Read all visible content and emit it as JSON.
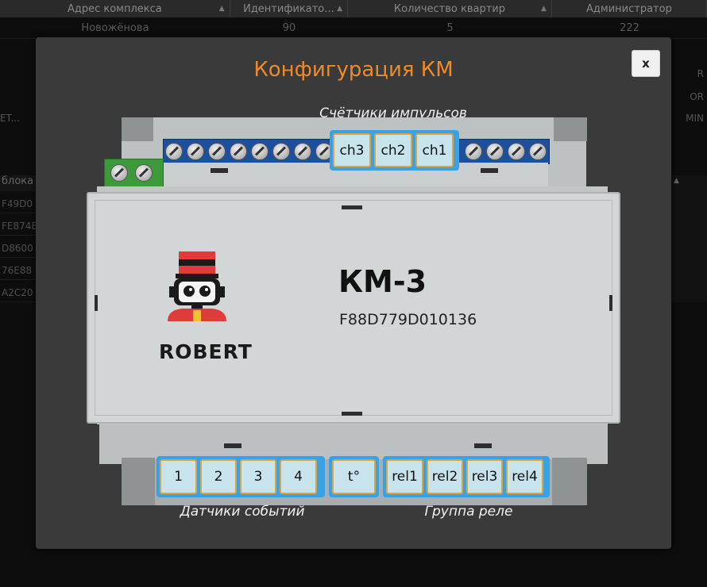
{
  "background_table": {
    "headers": [
      "Адрес комплекса",
      "Идентификато...",
      "Количество квартир",
      "Администратор"
    ],
    "row": [
      "Новожёнова",
      "90",
      "5",
      "222"
    ],
    "right_partial": [
      "R",
      "OR",
      "MIN"
    ],
    "left_header": "блока",
    "left_partial": [
      "ET...",
      "F49D0",
      "FE874B",
      "D8600",
      "76E88",
      "A2C20"
    ]
  },
  "modal": {
    "title": "Конфигурация КМ",
    "close_label": "x",
    "counters_caption": "Счётчики импульсов",
    "events_caption": "Датчики событий",
    "relay_caption": "Группа реле"
  },
  "device": {
    "brand": "ROBERT",
    "model": "КМ-3",
    "serial": "F88D779D010136"
  },
  "channels": {
    "counters": [
      "ch3",
      "ch2",
      "ch1"
    ],
    "sensors": [
      "1",
      "2",
      "3",
      "4"
    ],
    "temperature": "t°",
    "relays": [
      "rel1",
      "rel2",
      "rel3",
      "rel4"
    ]
  },
  "colors": {
    "title": "#ef8a26",
    "group_border": "#37a3e6",
    "chip_fill": "#c7e4ec",
    "chip_border": "#e0a33e"
  }
}
